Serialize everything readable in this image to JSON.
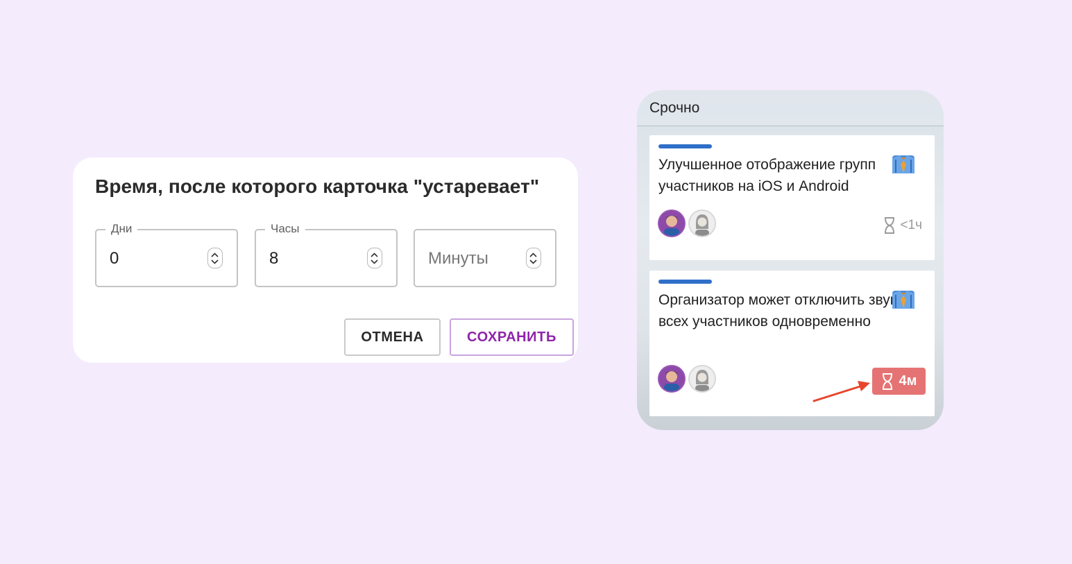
{
  "dialog": {
    "title": "Время, после которого карточка \"устаревает\"",
    "fields": [
      {
        "label": "Дни",
        "value": "0"
      },
      {
        "label": "Часы",
        "value": "8"
      },
      {
        "label": "",
        "value": "",
        "placeholder": "Минуты"
      }
    ],
    "cancel_label": "ОТМЕНА",
    "save_label": "СОХРАНИТЬ"
  },
  "board": {
    "column_title": "Срочно",
    "cards": [
      {
        "title": "Улучшенное отображение групп участников на iOS и Android",
        "timer": "<1ч",
        "overdue": false
      },
      {
        "title": "Организатор может отключить звук у всех участников одновременно",
        "timer": "4м",
        "overdue": true
      }
    ]
  },
  "colors": {
    "background": "#f4ebfd",
    "accent": "#8e24aa",
    "card_bar": "#2f6fc8",
    "overdue_badge": "#e57373",
    "arrow": "#e8452c"
  },
  "icons": {
    "role": "necktie-icon",
    "timer": "hourglass-icon"
  }
}
